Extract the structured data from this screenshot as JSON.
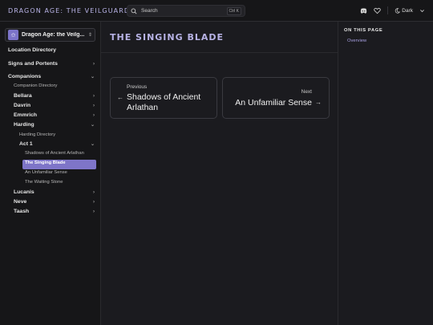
{
  "header": {
    "site_title": "DRAGON AGE: THE VEILGUARD",
    "search_placeholder": "Search",
    "search_shortcut": "Ctrl K",
    "theme_label": "Dark"
  },
  "sidebar": {
    "game_name": "Dragon Age: the Veilg...",
    "items": [
      {
        "label": "Location Directory"
      },
      {
        "label": "Signs and Portents"
      },
      {
        "label": "Companions"
      },
      {
        "label": "Companion Directory"
      },
      {
        "label": "Bellara"
      },
      {
        "label": "Davrin"
      },
      {
        "label": "Emmrich"
      },
      {
        "label": "Harding"
      },
      {
        "label": "Harding Directory"
      },
      {
        "label": "Act 1"
      },
      {
        "label": "Shadows of Ancient Arlathan"
      },
      {
        "label": "The Singing Blade"
      },
      {
        "label": "An Unfamiliar Sense"
      },
      {
        "label": "The Waiting Stone"
      },
      {
        "label": "Lucanis"
      },
      {
        "label": "Neve"
      },
      {
        "label": "Taash"
      }
    ]
  },
  "main": {
    "title": "THE SINGING BLADE",
    "prev": {
      "label": "Previous",
      "title_line1": "Shadows of Ancient",
      "title_line2": "Arlathan"
    },
    "next": {
      "label": "Next",
      "title": "An Unfamiliar Sense"
    }
  },
  "aside": {
    "heading": "ON THIS PAGE",
    "links": [
      {
        "label": "Overview"
      }
    ]
  },
  "colors": {
    "accent": "#7e75c8",
    "accent_text": "#b8b3e6",
    "background": "#1b1b1f",
    "sidebar_bg": "#161618"
  }
}
